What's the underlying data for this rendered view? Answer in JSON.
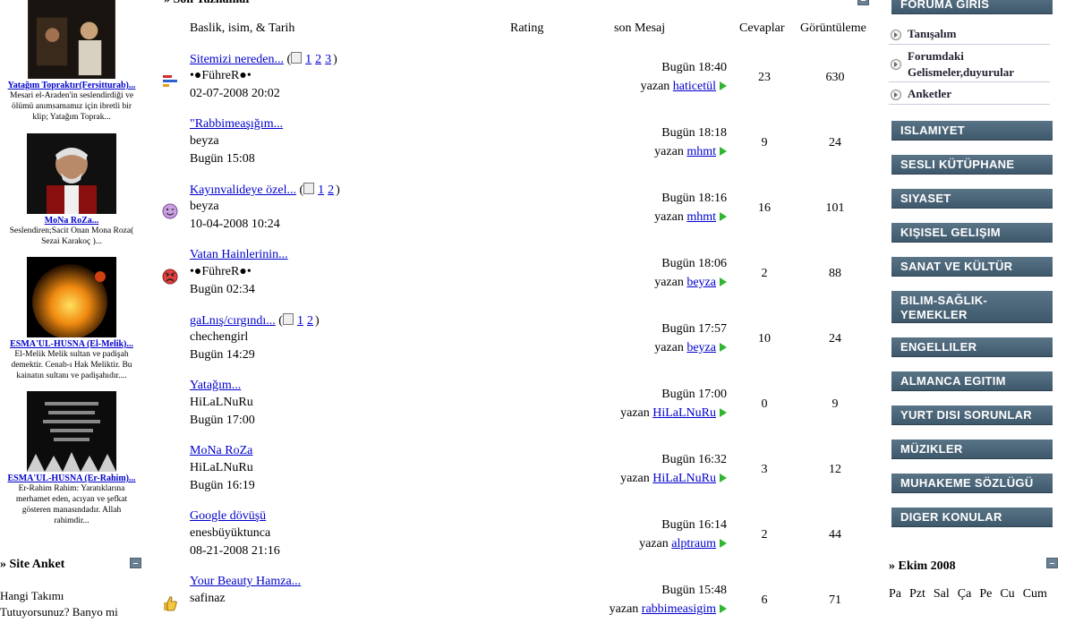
{
  "left": {
    "videos": [
      {
        "title": "Yatağım Topraktır(Fersitturab)...",
        "desc": "Mesari el-Araden'in seslendirdiği ve ölümü anımsamamız için ibretli bir klip; Yatağım Toprak..."
      },
      {
        "title": "MoNa RoZa...",
        "desc": "Seslendiren;Sacit Onan Mona Roza( Sezai Karakoç )..."
      },
      {
        "title": "ESMA'ÜL-HÜSNA (El-Melik)...",
        "desc": "El-Melik Melik sultan ve padişah demektir. Cenab-ı Hak Meliktir. Bu kainatın sultanı ve padişahıdır...."
      },
      {
        "title": "ESMA'ÜL-HÜSNA (Er-Rahim)...",
        "desc": "Er-Rahim Rahim: Yaratıklarına merhamet eden, acıyan ve şefkat gösteren manasındadır. Allah rahimdir..."
      }
    ],
    "anket_title": "» Site Anket",
    "anket_question": "Hangi Takımı",
    "anket_question2": "Tutuyorsunuz? Banyo mi"
  },
  "center": {
    "section_title": "» Son Yazılanlar",
    "columns": {
      "subject": "Baslik, isim, & Tarih",
      "rating": "Rating",
      "last": "son Mesaj",
      "replies": "Cevaplar",
      "views": "Görüntüleme"
    },
    "by_label": "yazan",
    "threads": [
      {
        "title": "Sitemizi nereden...",
        "pages": [
          "1",
          "2",
          "3"
        ],
        "author": "•●FühreR●•",
        "date": "02-07-2008 20:02",
        "last_time": "Bugün 18:40",
        "last_user": "haticetül",
        "replies": "23",
        "views": "630",
        "icon": "poll-icon"
      },
      {
        "title": "\"Rabbimeaşığım...",
        "pages": [],
        "author": "beyza",
        "date": "Bugün 15:08",
        "last_time": "Bugün 18:18",
        "last_user": "mhmt",
        "replies": "9",
        "views": "24",
        "icon": ""
      },
      {
        "title": "Kayınvalideye özel...",
        "pages": [
          "1",
          "2"
        ],
        "author": "beyza",
        "date": "10-04-2008 10:24",
        "last_time": "Bugün 18:16",
        "last_user": "mhmt",
        "replies": "16",
        "views": "101",
        "icon": "wink-icon"
      },
      {
        "title": "Vatan Hainlerinin...",
        "pages": [],
        "author": "•●FühreR●•",
        "date": "Bugün 02:34",
        "last_time": "Bugün 18:06",
        "last_user": "beyza",
        "replies": "2",
        "views": "88",
        "icon": "angry-icon"
      },
      {
        "title": "gaLnış/cırgındı...",
        "pages": [
          "1",
          "2"
        ],
        "author": "chechengirl",
        "date": "Bugün 14:29",
        "last_time": "Bugün 17:57",
        "last_user": "beyza",
        "replies": "10",
        "views": "24",
        "icon": ""
      },
      {
        "title": "Yatağım...",
        "pages": [],
        "author": "HiLaLNuRu",
        "date": "Bugün 17:00",
        "last_time": "Bugün 17:00",
        "last_user": "HiLaLNuRu",
        "replies": "0",
        "views": "9",
        "icon": ""
      },
      {
        "title": "MoNa RoZa",
        "pages": [],
        "author": "HiLaLNuRu",
        "date": "Bugün 16:19",
        "last_time": "Bugün 16:32",
        "last_user": "HiLaLNuRu",
        "replies": "3",
        "views": "12",
        "icon": ""
      },
      {
        "title": "Google dövüşü",
        "pages": [],
        "author": "enesbüyüktunca",
        "date": "08-21-2008 21:16",
        "last_time": "Bugün 16:14",
        "last_user": "alptraum",
        "replies": "2",
        "views": "44",
        "icon": ""
      },
      {
        "title": "Your Beauty Hamza...",
        "pages": [],
        "author": "safinaz",
        "date": "",
        "last_time": "Bugün 15:48",
        "last_user": "rabbimeasigim",
        "replies": "6",
        "views": "71",
        "icon": "thumbs-up-icon"
      }
    ]
  },
  "right": {
    "forum_login": "FORUMA GIRIS",
    "sub_items": [
      "Tanışalım",
      "Forumdaki Gelismeler,duyurular",
      "Anketler"
    ],
    "nav": [
      "ISLAMIYET",
      "SESLI KÜTÜPHANE",
      "SIYASET",
      "KIŞISEL GELIŞIM",
      "SANAT VE KÜLTÜR",
      "BILIM-SAĞLIK-YEMEKLER",
      "ENGELLILER",
      "ALMANCA EGITIM",
      "YURT DISI SORUNLAR",
      "MÜZIKLER",
      "MUHAKEME SÖZLÜGÜ",
      "DIGER KONULAR"
    ],
    "calendar_title": "» Ekim 2008",
    "weekdays": [
      "Pa",
      "Pzt",
      "Sal",
      "Ça",
      "Pe",
      "Cu",
      "Cum"
    ]
  },
  "colors": {
    "link": "#0000cc",
    "nav_bg": "#4b6578",
    "arrow": "#2fb52f"
  }
}
